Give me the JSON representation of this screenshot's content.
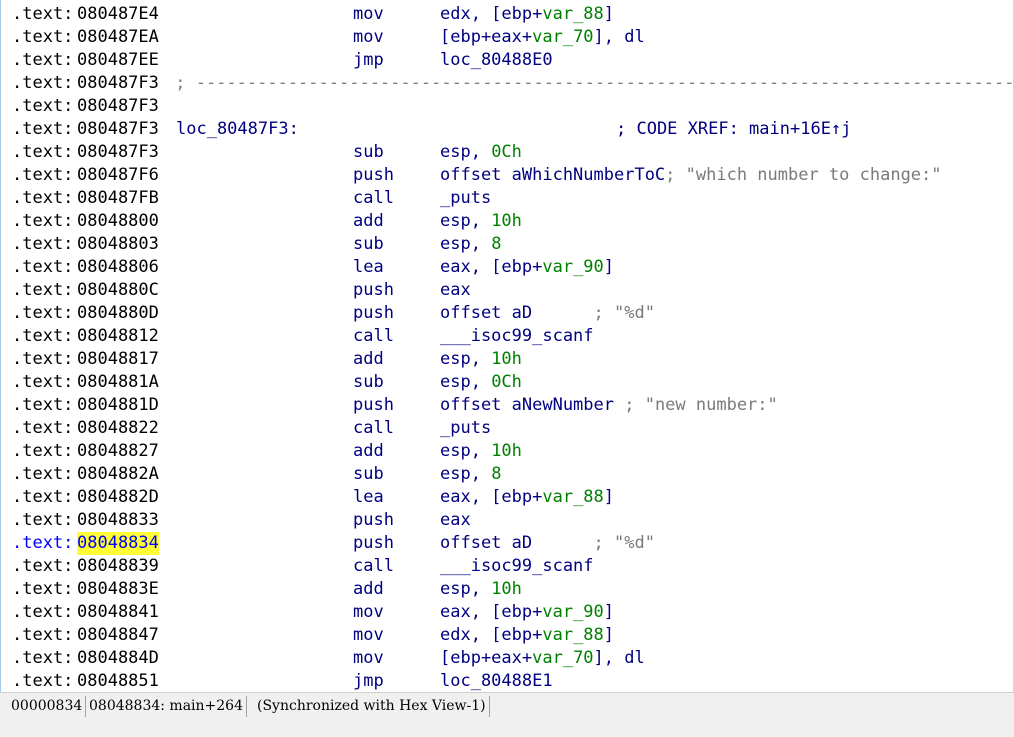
{
  "lines": [
    {
      "seg": ".text:",
      "addr": "080487E4",
      "mnem": "mov",
      "ops": [
        {
          "t": "edx, [ebp+",
          "c": "n"
        },
        {
          "t": "var_88",
          "c": "g"
        },
        {
          "t": "]",
          "c": "n"
        }
      ],
      "cmt": ""
    },
    {
      "seg": ".text:",
      "addr": "080487EA",
      "mnem": "mov",
      "ops": [
        {
          "t": "[ebp+eax+",
          "c": "n"
        },
        {
          "t": "var_70",
          "c": "g"
        },
        {
          "t": "], dl",
          "c": "n"
        }
      ],
      "cmt": ""
    },
    {
      "seg": ".text:",
      "addr": "080487EE",
      "mnem": "jmp",
      "ops": [
        {
          "t": "loc_80488E0",
          "c": "n"
        }
      ],
      "cmt": ""
    },
    {
      "seg": ".text:",
      "addr": "080487F3",
      "sep": " ; ----------------------------------------------------------------------------------"
    },
    {
      "seg": ".text:",
      "addr": "080487F3"
    },
    {
      "seg": ".text:",
      "addr": "080487F3",
      "label": "loc_80487F3:",
      "xref": "; CODE XREF: main+16E↑j"
    },
    {
      "seg": ".text:",
      "addr": "080487F3",
      "mnem": "sub",
      "ops": [
        {
          "t": "esp, ",
          "c": "n"
        },
        {
          "t": "0Ch",
          "c": "g"
        }
      ],
      "cmt": ""
    },
    {
      "seg": ".text:",
      "addr": "080487F6",
      "mnem": "push",
      "ops": [
        {
          "t": "offset aWhichNumberToC",
          "c": "n"
        }
      ],
      "cmt": "; \"which number to change:\""
    },
    {
      "seg": ".text:",
      "addr": "080487FB",
      "mnem": "call",
      "ops": [
        {
          "t": "_puts",
          "c": "n"
        }
      ],
      "cmt": ""
    },
    {
      "seg": ".text:",
      "addr": "08048800",
      "mnem": "add",
      "ops": [
        {
          "t": "esp, ",
          "c": "n"
        },
        {
          "t": "10h",
          "c": "g"
        }
      ],
      "cmt": ""
    },
    {
      "seg": ".text:",
      "addr": "08048803",
      "mnem": "sub",
      "ops": [
        {
          "t": "esp, ",
          "c": "n"
        },
        {
          "t": "8",
          "c": "g"
        }
      ],
      "cmt": ""
    },
    {
      "seg": ".text:",
      "addr": "08048806",
      "mnem": "lea",
      "ops": [
        {
          "t": "eax, [ebp+",
          "c": "n"
        },
        {
          "t": "var_90",
          "c": "g"
        },
        {
          "t": "]",
          "c": "n"
        }
      ],
      "cmt": ""
    },
    {
      "seg": ".text:",
      "addr": "0804880C",
      "mnem": "push",
      "ops": [
        {
          "t": "eax",
          "c": "n"
        }
      ],
      "cmt": ""
    },
    {
      "seg": ".text:",
      "addr": "0804880D",
      "mnem": "push",
      "ops": [
        {
          "t": "offset aD",
          "c": "n"
        }
      ],
      "cmt": "      ; \"%d\""
    },
    {
      "seg": ".text:",
      "addr": "08048812",
      "mnem": "call",
      "ops": [
        {
          "t": "___isoc99_scanf",
          "c": "n"
        }
      ],
      "cmt": ""
    },
    {
      "seg": ".text:",
      "addr": "08048817",
      "mnem": "add",
      "ops": [
        {
          "t": "esp, ",
          "c": "n"
        },
        {
          "t": "10h",
          "c": "g"
        }
      ],
      "cmt": ""
    },
    {
      "seg": ".text:",
      "addr": "0804881A",
      "mnem": "sub",
      "ops": [
        {
          "t": "esp, ",
          "c": "n"
        },
        {
          "t": "0Ch",
          "c": "g"
        }
      ],
      "cmt": ""
    },
    {
      "seg": ".text:",
      "addr": "0804881D",
      "mnem": "push",
      "ops": [
        {
          "t": "offset aNewNumber",
          "c": "n"
        }
      ],
      "cmt": " ; \"new number:\""
    },
    {
      "seg": ".text:",
      "addr": "08048822",
      "mnem": "call",
      "ops": [
        {
          "t": "_puts",
          "c": "n"
        }
      ],
      "cmt": ""
    },
    {
      "seg": ".text:",
      "addr": "08048827",
      "mnem": "add",
      "ops": [
        {
          "t": "esp, ",
          "c": "n"
        },
        {
          "t": "10h",
          "c": "g"
        }
      ],
      "cmt": ""
    },
    {
      "seg": ".text:",
      "addr": "0804882A",
      "mnem": "sub",
      "ops": [
        {
          "t": "esp, ",
          "c": "n"
        },
        {
          "t": "8",
          "c": "g"
        }
      ],
      "cmt": ""
    },
    {
      "seg": ".text:",
      "addr": "0804882D",
      "mnem": "lea",
      "ops": [
        {
          "t": "eax, [ebp+",
          "c": "n"
        },
        {
          "t": "var_88",
          "c": "g"
        },
        {
          "t": "]",
          "c": "n"
        }
      ],
      "cmt": ""
    },
    {
      "seg": ".text:",
      "addr": "08048833",
      "mnem": "push",
      "ops": [
        {
          "t": "eax",
          "c": "n"
        }
      ],
      "cmt": ""
    },
    {
      "seg": ".text:",
      "addr": "08048834",
      "mnem": "push",
      "ops": [
        {
          "t": "offset aD",
          "c": "n"
        }
      ],
      "cmt": "      ; \"%d\"",
      "current": true
    },
    {
      "seg": ".text:",
      "addr": "08048839",
      "mnem": "call",
      "ops": [
        {
          "t": "___isoc99_scanf",
          "c": "n"
        }
      ],
      "cmt": ""
    },
    {
      "seg": ".text:",
      "addr": "0804883E",
      "mnem": "add",
      "ops": [
        {
          "t": "esp, ",
          "c": "n"
        },
        {
          "t": "10h",
          "c": "g"
        }
      ],
      "cmt": ""
    },
    {
      "seg": ".text:",
      "addr": "08048841",
      "mnem": "mov",
      "ops": [
        {
          "t": "eax, [ebp+",
          "c": "n"
        },
        {
          "t": "var_90",
          "c": "g"
        },
        {
          "t": "]",
          "c": "n"
        }
      ],
      "cmt": ""
    },
    {
      "seg": ".text:",
      "addr": "08048847",
      "mnem": "mov",
      "ops": [
        {
          "t": "edx, [ebp+",
          "c": "n"
        },
        {
          "t": "var_88",
          "c": "g"
        },
        {
          "t": "]",
          "c": "n"
        }
      ],
      "cmt": ""
    },
    {
      "seg": ".text:",
      "addr": "0804884D",
      "mnem": "mov",
      "ops": [
        {
          "t": "[ebp+eax+",
          "c": "n"
        },
        {
          "t": "var_70",
          "c": "g"
        },
        {
          "t": "], dl",
          "c": "n"
        }
      ],
      "cmt": ""
    },
    {
      "seg": ".text:",
      "addr": "08048851",
      "mnem": "jmp",
      "ops": [
        {
          "t": "loc_80488E1",
          "c": "n"
        }
      ],
      "cmt": ""
    }
  ],
  "status": {
    "offset": "00000834",
    "location": "08048834: main+264",
    "sync": "(Synchronized with Hex View-1)"
  },
  "colors": {
    "highlight": "#ffff33",
    "operand_navy": "#000080",
    "operand_green": "#008000",
    "comment_gray": "#7a7a7a",
    "current_line_blue": "#0000ff"
  }
}
